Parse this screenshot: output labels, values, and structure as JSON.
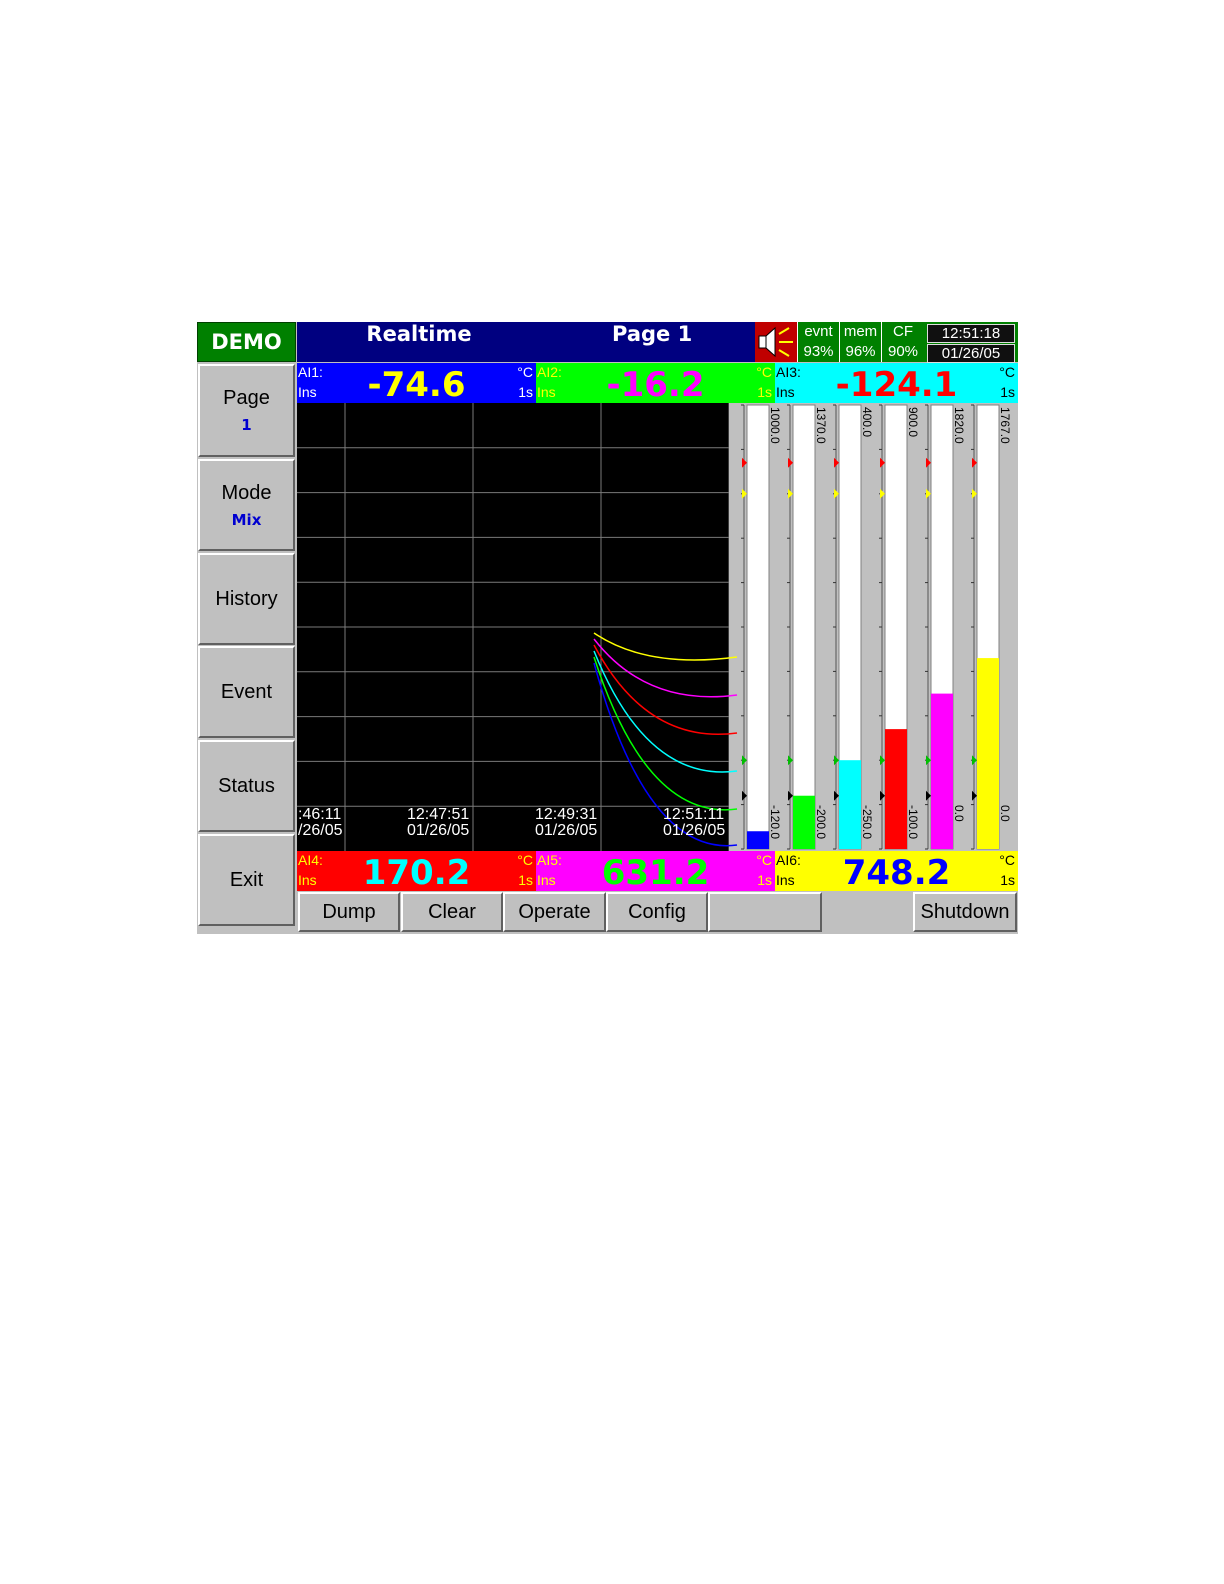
{
  "title_bar": {
    "demo_label": "DEMO",
    "mode_title": "Realtime",
    "page_title": "Page 1"
  },
  "status": {
    "evnt": {
      "label": "evnt",
      "value": "93%"
    },
    "mem": {
      "label": "mem",
      "value": "96%"
    },
    "cf": {
      "label": "CF",
      "value": "90%"
    },
    "time": "12:51:18",
    "date": "01/26/05"
  },
  "left_menu": {
    "page": {
      "label": "Page",
      "value": "1"
    },
    "mode": {
      "label": "Mode",
      "value": "Mix"
    },
    "history": "History",
    "event": "Event",
    "status": "Status",
    "exit": "Exit"
  },
  "channels": [
    {
      "name": "AI1:",
      "mode": "Ins",
      "unit": "°C",
      "rate": "1s",
      "value": "-74.6",
      "bg": "#0000ff",
      "fg": "#ffff00",
      "label_color": "#ffffff"
    },
    {
      "name": "AI2:",
      "mode": "Ins",
      "unit": "°C",
      "rate": "1s",
      "value": "-16.2",
      "bg": "#00ff00",
      "fg": "#ff00ff",
      "label_color": "#ffff00"
    },
    {
      "name": "AI3:",
      "mode": "Ins",
      "unit": "°C",
      "rate": "1s",
      "value": "-124.1",
      "bg": "#00ffff",
      "fg": "#ff0000",
      "label_color": "#000000"
    },
    {
      "name": "AI4:",
      "mode": "Ins",
      "unit": "°C",
      "rate": "1s",
      "value": "170.2",
      "bg": "#ff0000",
      "fg": "#00ffff",
      "label_color": "#ffff00"
    },
    {
      "name": "AI5:",
      "mode": "Ins",
      "unit": "°C",
      "rate": "1s",
      "value": "631.2",
      "bg": "#ff00ff",
      "fg": "#00ff00",
      "label_color": "#ffff00"
    },
    {
      "name": "AI6:",
      "mode": "Ins",
      "unit": "°C",
      "rate": "1s",
      "value": "748.2",
      "bg": "#ffff00",
      "fg": "#0000ff",
      "label_color": "#000000"
    }
  ],
  "trend": {
    "time_labels": [
      {
        "time": ":46:11",
        "date": "/26/05"
      },
      {
        "time": "12:47:51",
        "date": "01/26/05"
      },
      {
        "time": "12:49:31",
        "date": "01/26/05"
      },
      {
        "time": "12:51:11",
        "date": "01/26/05"
      }
    ]
  },
  "bar_graphs": [
    {
      "top": "1000.0",
      "bottom": "-120.0",
      "color": "#0000ff",
      "level": 0.04
    },
    {
      "top": "1370.0",
      "bottom": "-200.0",
      "color": "#00ff00",
      "level": 0.12
    },
    {
      "top": "400.0",
      "bottom": "-250.0",
      "color": "#00ffff",
      "level": 0.2
    },
    {
      "top": "900.0",
      "bottom": "-100.0",
      "color": "#ff0000",
      "level": 0.27
    },
    {
      "top": "1820.0",
      "bottom": "0.0",
      "color": "#ff00ff",
      "level": 0.35
    },
    {
      "top": "1767.0",
      "bottom": "0.0",
      "color": "#ffff00",
      "level": 0.43
    }
  ],
  "bottom_menu": {
    "dump": "Dump",
    "clear": "Clear",
    "operate": "Operate",
    "config": "Config",
    "blank": "",
    "shutdown": "Shutdown"
  }
}
